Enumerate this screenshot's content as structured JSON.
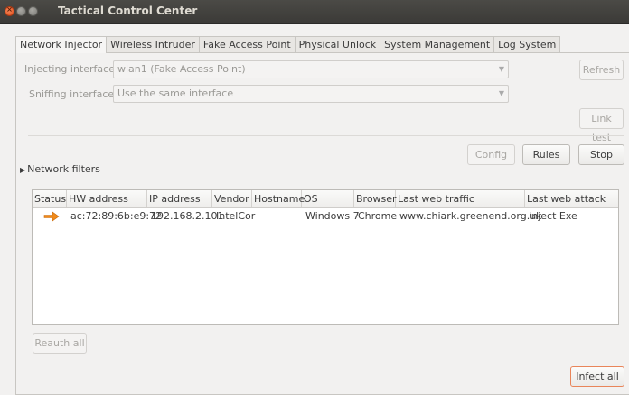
{
  "window": {
    "title": "Tactical Control Center"
  },
  "tabs": [
    {
      "label": "Network Injector",
      "active": true
    },
    {
      "label": "Wireless Intruder"
    },
    {
      "label": "Fake Access Point"
    },
    {
      "label": "Physical Unlock"
    },
    {
      "label": "System Management"
    },
    {
      "label": "Log System"
    }
  ],
  "form": {
    "injecting_label": "Injecting interface:",
    "injecting_value": "wlan1 (Fake Access Point)",
    "sniffing_label": "Sniffing interface:",
    "sniffing_value": "Use the same interface"
  },
  "buttons": {
    "refresh": "Refresh",
    "link_test": "Link test",
    "config": "Config",
    "rules": "Rules",
    "stop": "Stop",
    "reauth_all": "Reauth all",
    "infect_all": "Infect all"
  },
  "filters": {
    "label": "Network filters"
  },
  "table": {
    "columns": [
      "Status",
      "HW address",
      "IP address",
      "Vendor",
      "Hostname",
      "OS",
      "Browser",
      "Last web traffic",
      "Last web attack"
    ],
    "rows": [
      {
        "status_icon": "right-arrow-icon",
        "hw": "ac:72:89:6b:e9:72",
        "ip": "192.168.2.101",
        "vendor": "IntelCor",
        "hostname": "",
        "os": "Windows 7",
        "browser": "Chrome",
        "last_traffic": "www.chiark.greenend.org.uk",
        "last_attack": "Inject Exe"
      }
    ]
  },
  "colors": {
    "accent": "#e9855a",
    "status_arrow": "#f08a1a"
  }
}
